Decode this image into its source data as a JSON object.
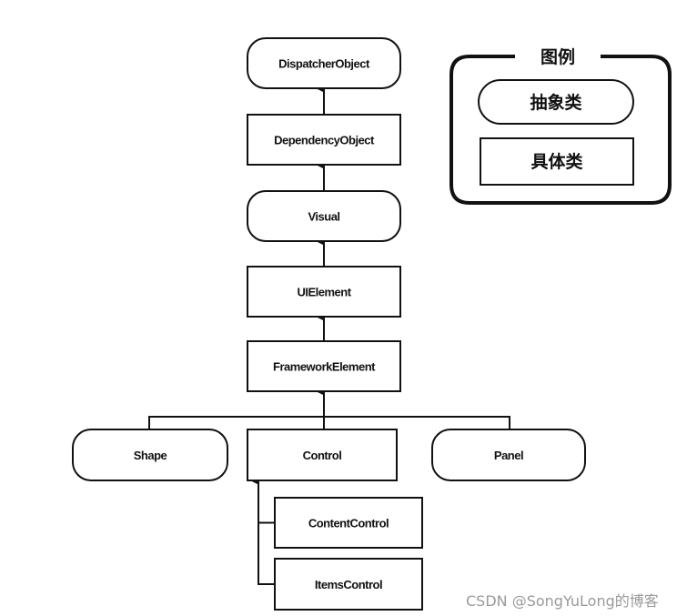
{
  "diagram": {
    "nodes": [
      {
        "id": "dispatcher",
        "label": "DispatcherObject",
        "kind": "abstract"
      },
      {
        "id": "dependency",
        "label": "DependencyObject",
        "kind": "concrete"
      },
      {
        "id": "visual",
        "label": "Visual",
        "kind": "abstract"
      },
      {
        "id": "uielement",
        "label": "UIElement",
        "kind": "concrete"
      },
      {
        "id": "framework",
        "label": "FrameworkElement",
        "kind": "concrete"
      },
      {
        "id": "shape",
        "label": "Shape",
        "kind": "abstract"
      },
      {
        "id": "control",
        "label": "Control",
        "kind": "concrete"
      },
      {
        "id": "panel",
        "label": "Panel",
        "kind": "abstract"
      },
      {
        "id": "contentcontrol",
        "label": "ContentControl",
        "kind": "concrete"
      },
      {
        "id": "itemscontrol",
        "label": "ItemsControl",
        "kind": "concrete"
      }
    ],
    "edges": [
      {
        "from": "dependency",
        "to": "dispatcher"
      },
      {
        "from": "visual",
        "to": "dependency"
      },
      {
        "from": "uielement",
        "to": "visual"
      },
      {
        "from": "framework",
        "to": "uielement"
      },
      {
        "from": "shape",
        "to": "framework"
      },
      {
        "from": "control",
        "to": "framework"
      },
      {
        "from": "panel",
        "to": "framework"
      },
      {
        "from": "contentcontrol",
        "to": "control"
      },
      {
        "from": "itemscontrol",
        "to": "control"
      }
    ]
  },
  "legend": {
    "title": "图例",
    "abstract_label": "抽象类",
    "concrete_label": "具体类"
  },
  "watermark": "CSDN @SongYuLong的博客"
}
